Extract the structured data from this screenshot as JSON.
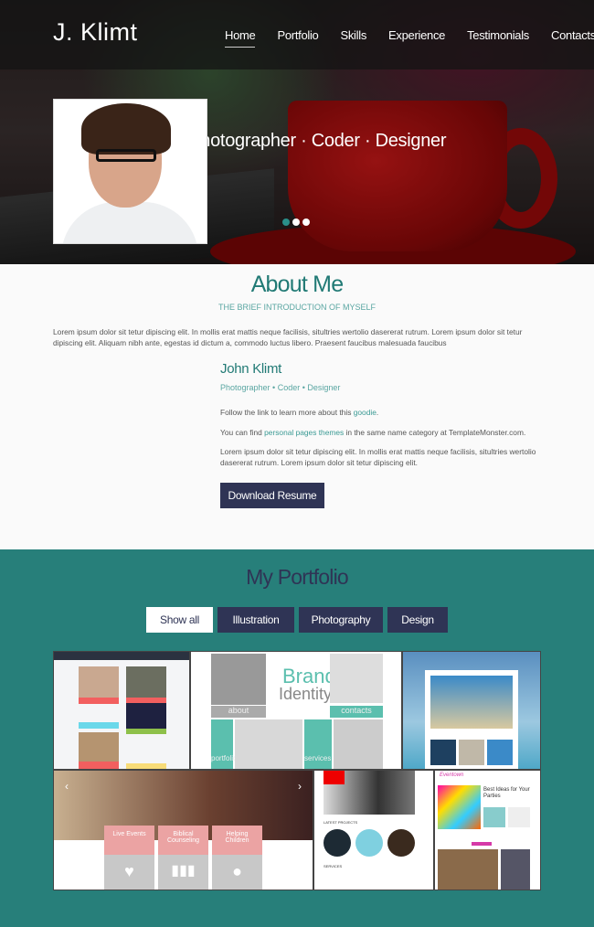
{
  "header": {
    "logo": "J. Klimt",
    "nav": [
      {
        "label": "Home",
        "active": true
      },
      {
        "label": "Portfolio"
      },
      {
        "label": "Skills"
      },
      {
        "label": "Experience"
      },
      {
        "label": "Testimonials"
      },
      {
        "label": "Contacts"
      }
    ]
  },
  "hero": {
    "tagline": "Your Photographer · Coder · Designer",
    "slides": 3,
    "active_slide": 1
  },
  "about": {
    "title": "About Me",
    "subtitle": "THE BRIEF INTRODUCTION OF MYSELF",
    "intro": "Lorem ipsum dolor sit tetur dipiscing elit. In mollis erat mattis neque facilisis, situltries wertolio dasererat rutrum. Lorem ipsum dolor sit tetur dipiscing elit. Aliquam nibh ante, egestas id dictum a, commodo luctus libero. Praesent faucibus malesuada faucibus",
    "name": "John Klimt",
    "role": "Photographer • Coder • Designer",
    "p1_prefix": "Follow the link to learn more about this ",
    "p1_link": "goodie",
    "p1_suffix": ".",
    "p2_prefix": "You can find ",
    "p2_link": "personal pages themes",
    "p2_suffix": " in the same name category at TemplateMonster.com.",
    "p3": "Lorem ipsum dolor sit tetur dipiscing elit. In mollis erat mattis neque facilisis, situltries wertolio dasererat rutrum. Lorem ipsum dolor sit tetur dipiscing elit.",
    "download_label": "Download Resume"
  },
  "portfolio": {
    "title": "My Portfolio",
    "filters": [
      {
        "label": "Show all",
        "active": true
      },
      {
        "label": "Illustration"
      },
      {
        "label": "Photography"
      },
      {
        "label": "Design"
      }
    ],
    "brand": {
      "title1": "Brand",
      "title2": "Identity",
      "about": "about",
      "contacts": "contacts",
      "portfolio": "portfolio",
      "services": "services"
    },
    "church": {
      "cards": [
        "Live Events",
        "Biblical Counseling",
        "Helping Children"
      ]
    },
    "photo_site": {
      "latest": "LATEST PROJECTS",
      "services": "SERVICES"
    },
    "party": {
      "logo": "Eventown",
      "headline": "Best Ideas for Your Parties"
    }
  },
  "colors": {
    "teal": "#277f7a",
    "navy": "#2f3455",
    "heading": "#217a75"
  }
}
